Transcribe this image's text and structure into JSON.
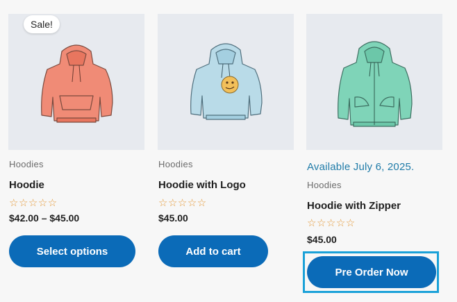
{
  "products": [
    {
      "badge": "Sale!",
      "category": "Hoodies",
      "title": "Hoodie",
      "rating_stars": "☆☆☆☆☆",
      "rating_value": 0,
      "price": "$42.00 – $45.00",
      "button_label": "Select options",
      "image": "orange-hoodie",
      "color": "#f08b76"
    },
    {
      "category": "Hoodies",
      "title": "Hoodie with Logo",
      "rating_stars": "☆☆☆☆☆",
      "rating_value": 0,
      "price": "$45.00",
      "button_label": "Add to cart",
      "image": "blue-hoodie-with-logo",
      "color": "#b9dbe8"
    },
    {
      "availability": "Available July 6, 2025.",
      "category": "Hoodies",
      "title": "Hoodie with Zipper",
      "rating_stars": "☆☆☆☆☆",
      "rating_value": 0,
      "price": "$45.00",
      "button_label": "Pre Order Now",
      "button_focused": true,
      "image": "green-zip-hoodie",
      "color": "#7fd4b8"
    }
  ],
  "theme": {
    "button_color": "#0b6bb8",
    "focus_color": "#1aa1d8",
    "availability_color": "#1f7ba8",
    "star_color": "#e49a3a"
  }
}
